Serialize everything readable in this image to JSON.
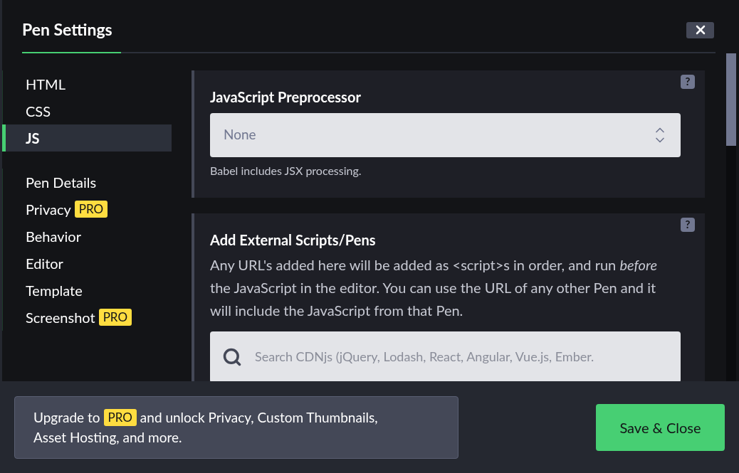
{
  "dialog": {
    "title": "Pen Settings"
  },
  "sidebar": {
    "groups": [
      [
        {
          "label": "HTML",
          "selected": false
        },
        {
          "label": "CSS",
          "selected": false
        },
        {
          "label": "JS",
          "selected": true
        }
      ],
      [
        {
          "label": "Pen Details",
          "selected": false
        },
        {
          "label": "Privacy",
          "badge": "PRO",
          "selected": false
        },
        {
          "label": "Behavior",
          "selected": false
        },
        {
          "label": "Editor",
          "selected": false
        },
        {
          "label": "Template",
          "selected": false
        },
        {
          "label": "Screenshot",
          "badge": "PRO",
          "selected": false
        }
      ]
    ]
  },
  "preprocessor": {
    "title": "JavaScript Preprocessor",
    "help": "?",
    "value": "None",
    "hint": "Babel includes JSX processing."
  },
  "external": {
    "title": "Add External Scripts/Pens",
    "help": "?",
    "description": "Any URL's added here will be added as <script>s in order, and run *before* the JavaScript in the editor. You can use the URL of any other Pen and it will include the JavaScript from that Pen.",
    "search_placeholder": "Search CDNjs (jQuery, Lodash, React, Angular, Vue.js, Ember."
  },
  "footer": {
    "upgrade_before": "Upgrade to",
    "upgrade_badge": "PRO",
    "upgrade_after": "and unlock Privacy, Custom Thumbnails,",
    "upgrade_line_2": "Asset Hosting, and more.",
    "save_button": "Save & Close"
  }
}
